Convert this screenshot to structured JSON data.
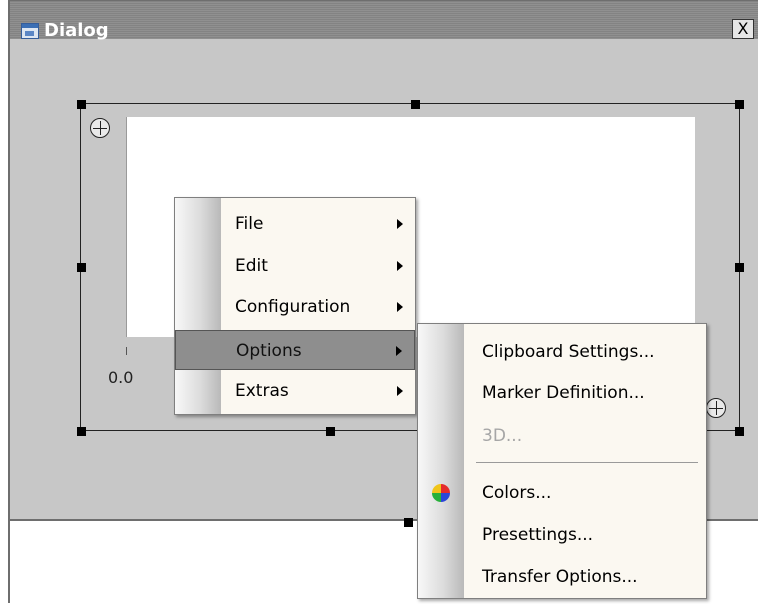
{
  "window": {
    "title": "Dialog",
    "close_label": "X"
  },
  "chart": {
    "x_axis_start": "0.0"
  },
  "context_menu": {
    "items": [
      {
        "label": "File"
      },
      {
        "label": "Edit"
      },
      {
        "label": "Configuration"
      },
      {
        "label": "Options"
      },
      {
        "label": "Extras"
      }
    ]
  },
  "options_submenu": {
    "items": [
      {
        "label": "Clipboard Settings..."
      },
      {
        "label": "Marker Definition..."
      },
      {
        "label": "3D..."
      },
      {
        "label": "Colors..."
      },
      {
        "label": "Presettings..."
      },
      {
        "label": "Transfer Options..."
      }
    ],
    "disabled": [
      "3D..."
    ]
  }
}
